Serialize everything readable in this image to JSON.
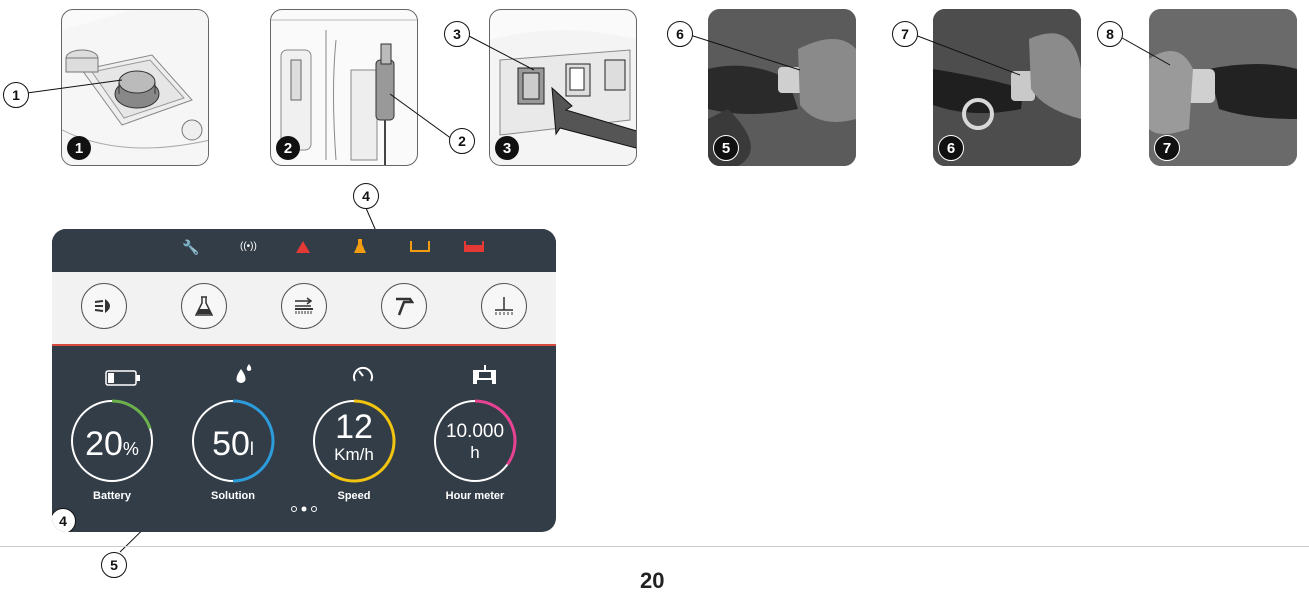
{
  "steps": {
    "photo_badges": [
      "1",
      "2",
      "3",
      "5",
      "6",
      "7"
    ],
    "callouts": [
      "1",
      "2",
      "3",
      "6",
      "7",
      "8",
      "4",
      "5"
    ],
    "panel_badge": "4"
  },
  "display": {
    "status_icons": [
      "wrench-icon",
      "wifi-icon",
      "warning-icon",
      "flask-icon",
      "tank-icon",
      "tank-full-icon"
    ],
    "status_colors": {
      "wrench": "#f39c12",
      "warning": "#e53935",
      "tank": "#f39c12",
      "tank_full": "#e53935"
    },
    "buttons": [
      "headlight-button",
      "detergent-button",
      "brush-button",
      "spray-gun-button",
      "squeegee-button"
    ],
    "gauges": [
      {
        "label": "Battery",
        "value": "20",
        "unit": "%",
        "color": "#6ab04c",
        "fraction": 0.2
      },
      {
        "label": "Solution",
        "value": "50",
        "unit": "l",
        "color": "#2d9cdb",
        "fraction": 0.5
      },
      {
        "label": "Speed",
        "value": "12",
        "unit": "Km/h",
        "color": "#f1c40f",
        "fraction": 0.6
      },
      {
        "label": "Hour meter",
        "value": "10.000",
        "unit": "h",
        "color": "#e84393",
        "fraction": 0.35
      }
    ]
  },
  "page_number": "20"
}
